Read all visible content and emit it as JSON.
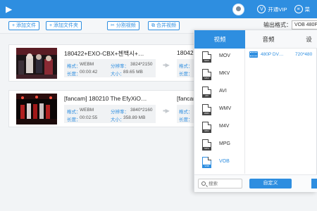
{
  "header": {
    "vip_label": "开通VIP",
    "menu_label": "菜"
  },
  "toolbar": {
    "add_file": "添加文件",
    "add_folder": "添加文件夹",
    "split_video": "分割视频",
    "merge_video": "合并视频",
    "output_format_label": "输出格式：",
    "output_format_value": "VOB 480P"
  },
  "files": [
    {
      "title": "180422+EXO-CBX+첸백시+…",
      "format_label": "格式：",
      "format": "WEBM",
      "resolution_label": "分辨率：",
      "resolution": "3824*2150",
      "duration_label": "长度：",
      "duration": "00:00:42",
      "size_label": "大小：",
      "size": "89.65 MB",
      "out_title": "180422",
      "out_format_label": "格式：",
      "out_duration_label": "长度："
    },
    {
      "title": "[fancam] 180210 The EfyXiO…",
      "format_label": "格式：",
      "format": "WEBM",
      "resolution_label": "分辨率：",
      "resolution": "3840*2160",
      "duration_label": "长度：",
      "duration": "00:02:55",
      "size_label": "大小：",
      "size": "358.89 MB",
      "out_title": "[fancam",
      "out_format_label": "格式：",
      "out_duration_label": "长度："
    }
  ],
  "format_panel": {
    "tabs": [
      "视频",
      "音频",
      "设"
    ],
    "active_tab": 0,
    "formats": [
      "MOV",
      "MKV",
      "AVI",
      "WMV",
      "M4V",
      "MPG",
      "VOB"
    ],
    "format_tags": [
      "MOV",
      "MKV",
      "AVI",
      "WMV",
      "M4V",
      "MPG",
      "VOB"
    ],
    "selected_format": "VOB",
    "resolution_options": [
      {
        "name": "480P DV…",
        "size": "720*480"
      }
    ],
    "search_placeholder": "搜索",
    "custom_button": "自定义",
    "accent": "#2e8ee0"
  }
}
